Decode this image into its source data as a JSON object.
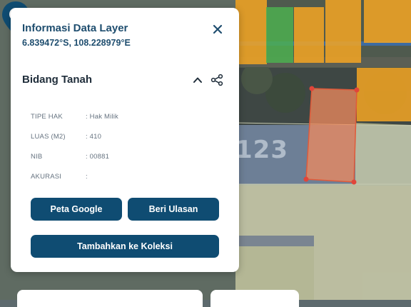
{
  "panel": {
    "title": "Informasi Data Layer",
    "coordinates": "6.839472°S, 108.228979°E",
    "close_icon": "close-icon"
  },
  "section": {
    "title": "Bidang Tanah",
    "collapse_icon": "chevron-up-icon",
    "share_icon": "share-icon"
  },
  "attributes": [
    {
      "key": "TIPE HAK",
      "value": ": Hak Milik"
    },
    {
      "key": "LUAS (M2)",
      "value": ": 410"
    },
    {
      "key": "NIB",
      "value": ": 00881"
    },
    {
      "key": "AKURASI",
      "value": ":"
    }
  ],
  "buttons": {
    "google_maps": "Peta Google",
    "review": "Beri Ulasan",
    "add_collection": "Tambahkan ke Koleksi"
  },
  "map": {
    "parcel_label": "123",
    "marker_icon": "map-pin-icon"
  },
  "colors": {
    "accent": "#0f4c72",
    "title": "#1f4e6f",
    "parcel_orange": "#f5a623",
    "parcel_selected": "#f08a5d",
    "parcel_green": "#4caf50",
    "parcel_pale": "#e8e4a0"
  }
}
